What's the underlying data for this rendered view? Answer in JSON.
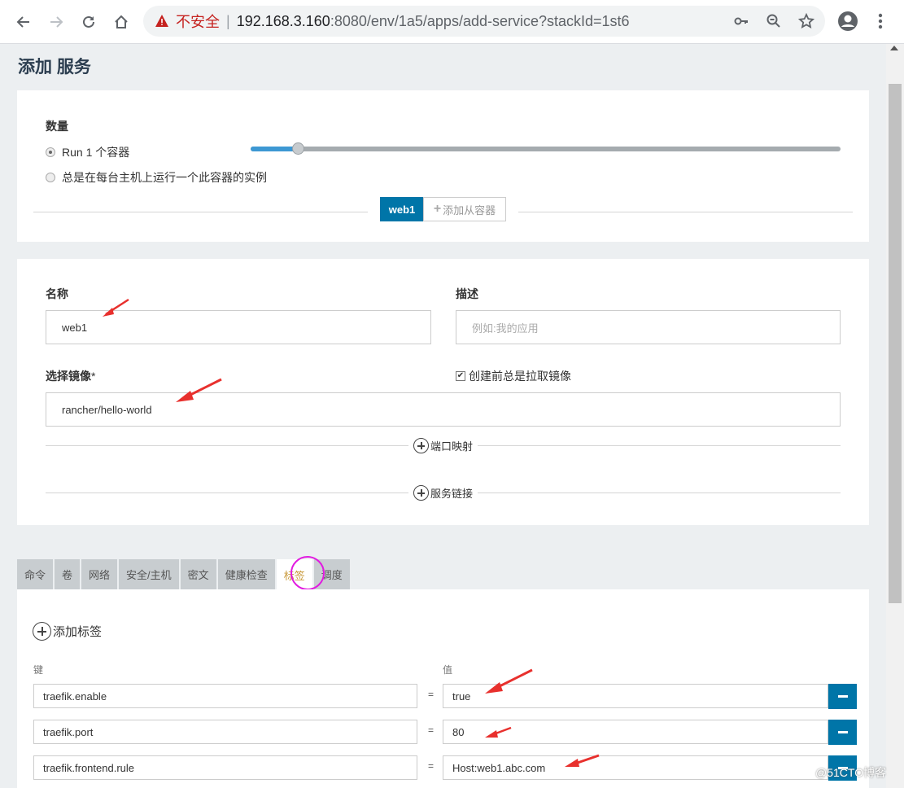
{
  "browser": {
    "insecure_label": "不安全",
    "separator": "|",
    "url_host": "192.168.3.160",
    "url_path": ":8080/env/1a5/apps/add-service?stackId=1st6"
  },
  "page": {
    "title": "添加 服务"
  },
  "scale": {
    "label": "数量",
    "option_run": "Run 1 个容器",
    "option_global": "总是在每台主机上运行一个此容器的实例",
    "selected": "run",
    "slider_level": 0.08
  },
  "container_tabs": {
    "current": "web1",
    "add_sidekick": "添加从容器"
  },
  "form": {
    "name_label": "名称",
    "name_value": "web1",
    "description_label": "描述",
    "description_placeholder": "例如:我的应用",
    "image_label": "选择镜像",
    "image_required_mark": "*",
    "image_value": "rancher/hello-world",
    "pull_image_checked": true,
    "pull_image_label": "创建前总是拉取镜像",
    "port_map_label": "端口映射",
    "service_links_label": "服务链接"
  },
  "tabs": [
    {
      "label": "命令",
      "active": false
    },
    {
      "label": "卷",
      "active": false
    },
    {
      "label": "网络",
      "active": false
    },
    {
      "label": "安全/主机",
      "active": false
    },
    {
      "label": "密文",
      "active": false
    },
    {
      "label": "健康检查",
      "active": false
    },
    {
      "label": "标签",
      "active": true
    },
    {
      "label": "调度",
      "active": false
    }
  ],
  "labels_section": {
    "add_label": "添加标签",
    "key_header": "键",
    "value_header": "值",
    "equals": "=",
    "rows": [
      {
        "key": "traefik.enable",
        "value": "true"
      },
      {
        "key": "traefik.port",
        "value": "80"
      },
      {
        "key": "traefik.frontend.rule",
        "value": "Host:web1.abc.com"
      }
    ]
  },
  "watermark": "@51CTO博客",
  "colors": {
    "primary": "#0075a8",
    "annotation_arrow": "#e8302d",
    "annotation_circle": "#e11be0"
  }
}
